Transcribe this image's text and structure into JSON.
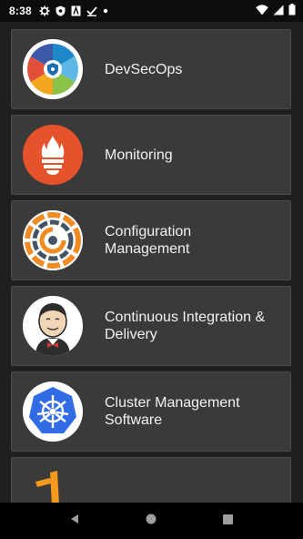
{
  "status_bar": {
    "time": "8:38",
    "icons": [
      "gear-icon",
      "shield-icon",
      "a-box-icon",
      "check-icon",
      "dot-icon"
    ],
    "right_icons": [
      "wifi-icon",
      "cellular-icon",
      "battery-icon"
    ]
  },
  "items": [
    {
      "label": "DevSecOps",
      "icon": "devsecops-wheel-icon"
    },
    {
      "label": "Monitoring",
      "icon": "prometheus-torch-icon"
    },
    {
      "label": "Configuration Management",
      "icon": "chef-circle-icon"
    },
    {
      "label": "Continuous Integration & Delivery",
      "icon": "jenkins-butler-icon"
    },
    {
      "label": "Cluster Management Software",
      "icon": "kubernetes-wheel-icon"
    },
    {
      "label": "",
      "icon": "partial-orange-icon"
    }
  ],
  "nav_bar": {
    "back": "back-icon",
    "home": "home-icon",
    "recents": "recents-icon"
  }
}
